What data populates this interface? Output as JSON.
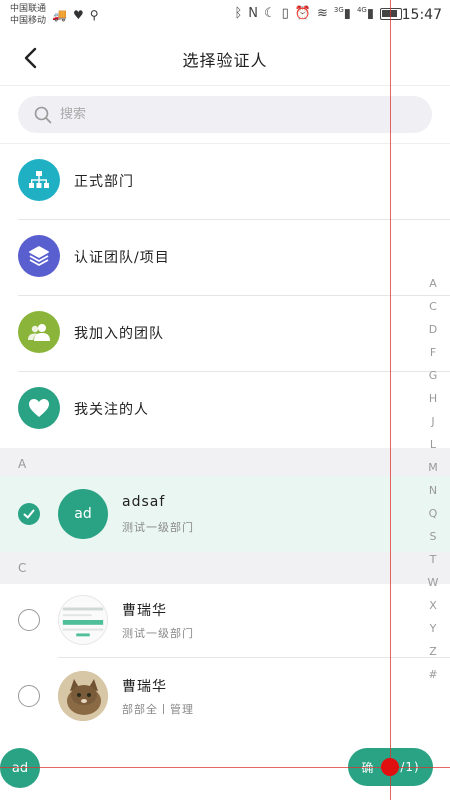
{
  "status_bar": {
    "carrier_1": "中国联通",
    "carrier_2": "中国移动",
    "net_1": "3G",
    "net_2": "4G",
    "time": "15:47"
  },
  "header": {
    "title": "选择验证人"
  },
  "search": {
    "placeholder": "搜索"
  },
  "categories": [
    {
      "label": "正式部门",
      "icon": "org-chart-icon",
      "color": "#1fb0c4"
    },
    {
      "label": "认证团队/项目",
      "icon": "layers-icon",
      "color": "#5a5fd0"
    },
    {
      "label": "我加入的团队",
      "icon": "group-icon",
      "color": "#8bb53a"
    },
    {
      "label": "我关注的人",
      "icon": "heart-icon",
      "color": "#2aa385"
    }
  ],
  "sections": [
    {
      "letter": "A",
      "people": [
        {
          "name": "adsaf",
          "dept": "测试一级部门",
          "avatar_text": "ad",
          "selected": true
        }
      ]
    },
    {
      "letter": "C",
      "people": [
        {
          "name": "曹瑞华",
          "dept": "测试一级部门",
          "avatar_text": "",
          "selected": false
        },
        {
          "name": "曹瑞华",
          "dept": "部部全丨管理",
          "avatar_text": "",
          "selected": false
        }
      ]
    }
  ],
  "index_letters": [
    "A",
    "C",
    "D",
    "F",
    "G",
    "H",
    "J",
    "L",
    "M",
    "N",
    "Q",
    "S",
    "T",
    "W",
    "X",
    "Y",
    "Z",
    "#"
  ],
  "bottom": {
    "chip_text": "ad",
    "confirm_label": "确",
    "confirm_count": "/1)"
  },
  "colors": {
    "accent": "#2aa385"
  }
}
